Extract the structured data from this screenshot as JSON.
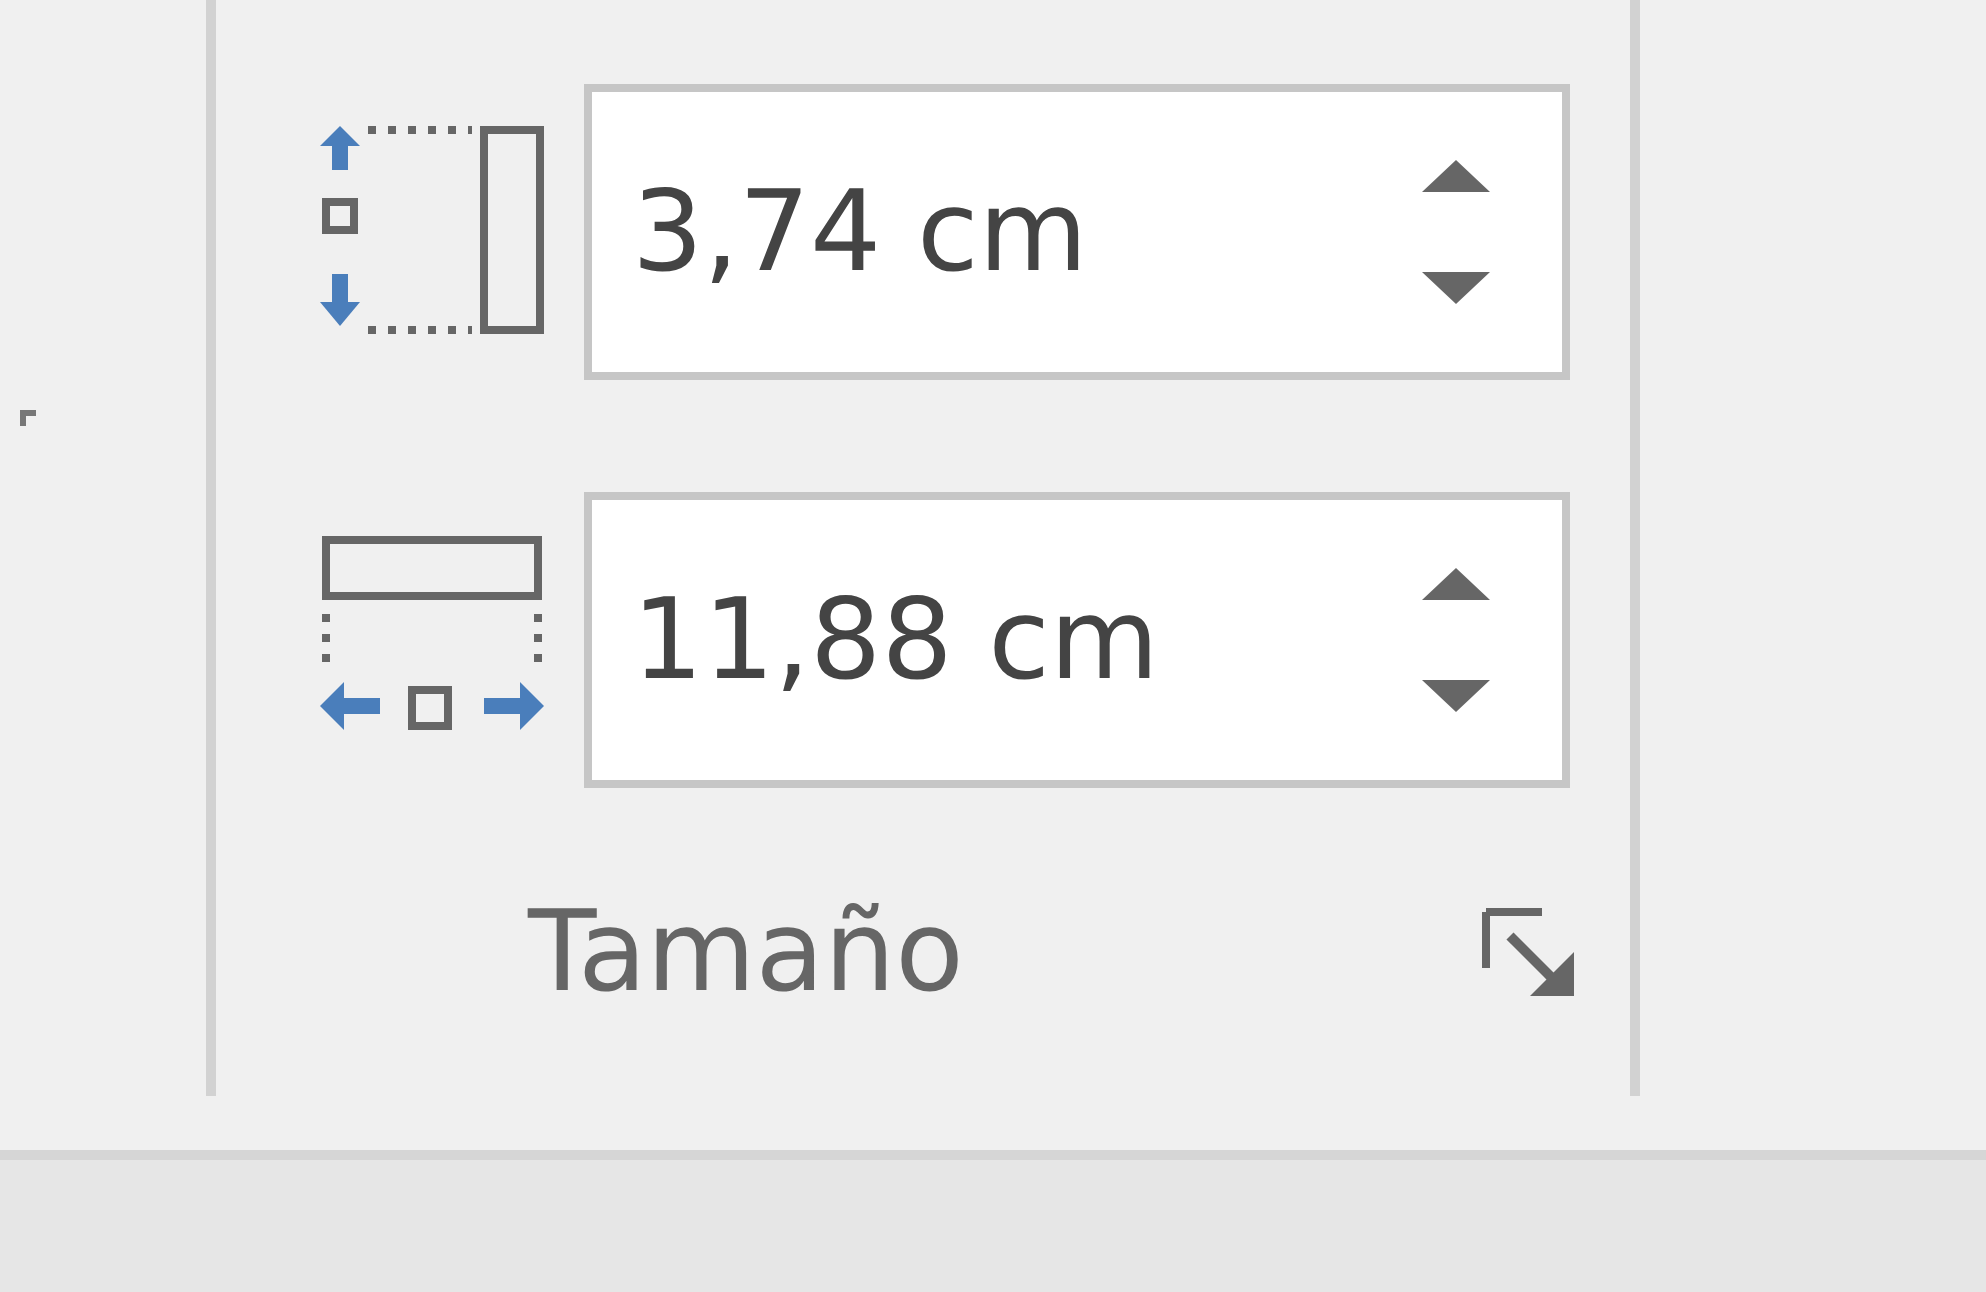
{
  "group": {
    "title": "Tamaño",
    "fields": [
      {
        "value": "3,74 cm"
      },
      {
        "value": "11,88 cm"
      }
    ]
  }
}
